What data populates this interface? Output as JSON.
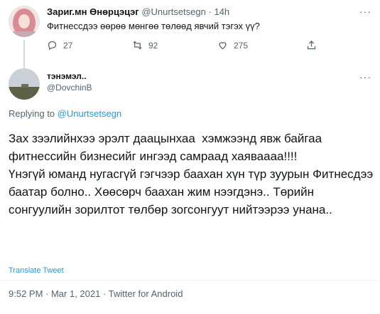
{
  "parent_tweet": {
    "display_name": "Зариг.мн Өнөрцэцэг",
    "handle": "@Unurtsetsegn",
    "separator": "·",
    "time": "14h",
    "text": "Фитнессдээ өөрөө мөнгөө төлөөд явчий тэгэх үү?",
    "more_icon": "more-icon",
    "reply_count": "27",
    "retweet_count": "92",
    "like_count": "275"
  },
  "main_tweet": {
    "display_name": "тэнэмэл..",
    "handle": "@DovchinB",
    "replying_prefix": "Replying to ",
    "replying_handle": "@Unurtsetsegn",
    "text": "Зах зээлийнхээ эрэлт даацынхаа  хэмжээнд явж байгаа фитнессийн бизнесийг ингээд самраад хаяваааа!!!!\nҮнэгүй юманд нугасгүй гэгчээр баахан хүн түр зуурын Фитнесдээ баатар болно.. Хөөсөрч баахан жим нээгдэнэ.. Төрийн сонгуулийн зорилтот төлбөр зогсонгуут нийтээрээ унана..",
    "translate_label": "Translate Tweet",
    "timestamp": "9:52 PM · Mar 1, 2021 · Twitter for Android"
  },
  "colors": {
    "text_primary": "#0f1419",
    "text_secondary": "#536471",
    "link_blue": "#1d9bf0"
  }
}
